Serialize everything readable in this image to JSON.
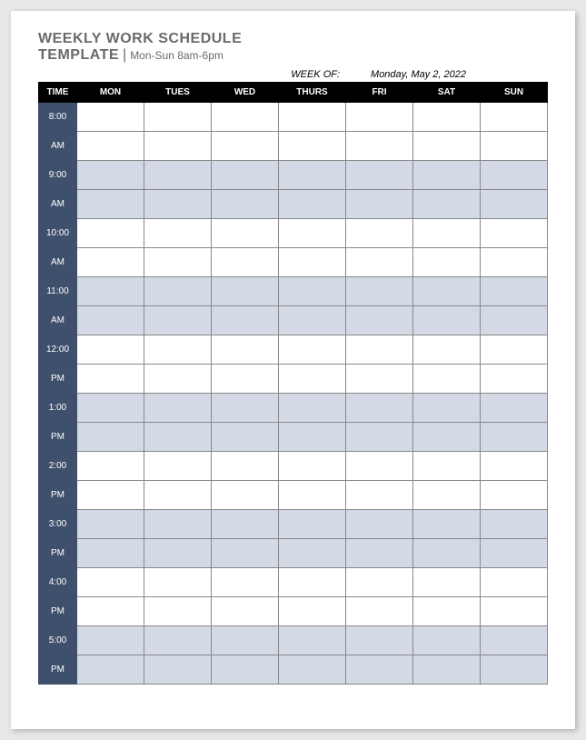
{
  "title": {
    "line1": "WEEKLY WORK SCHEDULE",
    "line2": "TEMPLATE",
    "divider": "|",
    "subtitle": "Mon-Sun 8am-6pm"
  },
  "weekof": {
    "label": "WEEK OF:",
    "value": "Monday, May 2, 2022"
  },
  "headers": {
    "time": "TIME",
    "days": [
      "MON",
      "TUES",
      "WED",
      "THURS",
      "FRI",
      "SAT",
      "SUN"
    ]
  },
  "time_rows": [
    {
      "hour": "8:00",
      "period": "AM",
      "shaded": false
    },
    {
      "hour": "9:00",
      "period": "AM",
      "shaded": true
    },
    {
      "hour": "10:00",
      "period": "AM",
      "shaded": false
    },
    {
      "hour": "11:00",
      "period": "AM",
      "shaded": true
    },
    {
      "hour": "12:00",
      "period": "PM",
      "shaded": false
    },
    {
      "hour": "1:00",
      "period": "PM",
      "shaded": true
    },
    {
      "hour": "2:00",
      "period": "PM",
      "shaded": false
    },
    {
      "hour": "3:00",
      "period": "PM",
      "shaded": true
    },
    {
      "hour": "4:00",
      "period": "PM",
      "shaded": false
    },
    {
      "hour": "5:00",
      "period": "PM",
      "shaded": true
    }
  ]
}
